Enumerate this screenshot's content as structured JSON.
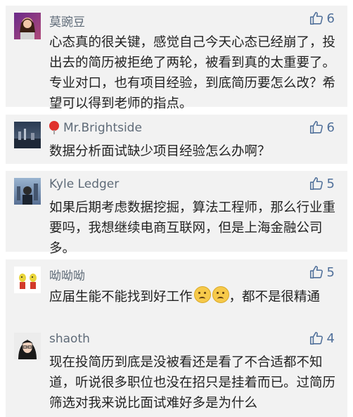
{
  "comments": [
    {
      "author": "莫豌豆",
      "likes": "6",
      "text": "心态真的很关键，感觉自己今天心态已经崩了，投出去的简历被拒绝了两轮，被看到真的太重要了。专业对口，也有项目经验，到底简历要怎么改？希望可以得到老师的指点。"
    },
    {
      "author": "Mr.Brightside",
      "likes": "6",
      "text": "数据分析面试缺少项目经验怎么办啊？"
    },
    {
      "author": "Kyle Ledger",
      "likes": "5",
      "text": "如果后期考虑数据挖掘，算法工程师，那么行业重要吗，我想继续电商互联网，但是上海金融公司多。"
    },
    {
      "author": "呦呦呦",
      "likes": "5",
      "text_before": "应届生能不能找到好工作",
      "text_after": "，都不是很精通"
    },
    {
      "author": "shaoth",
      "likes": "4",
      "text": "现在投简历到底是没被看还是看了不合适都不知道，听说很多职位也没在招只是挂着而已。过简历筛选对我来说比面试难好多是为什么"
    }
  ],
  "icons": {
    "like": "thumbs-up-outline-icon",
    "pin": "balloon-icon",
    "emoji": "confused-face-emoji-icon"
  },
  "colors": {
    "card_bg": "#f2f2f2",
    "name": "#5f6b78",
    "like": "#50709a",
    "text": "#222222"
  }
}
